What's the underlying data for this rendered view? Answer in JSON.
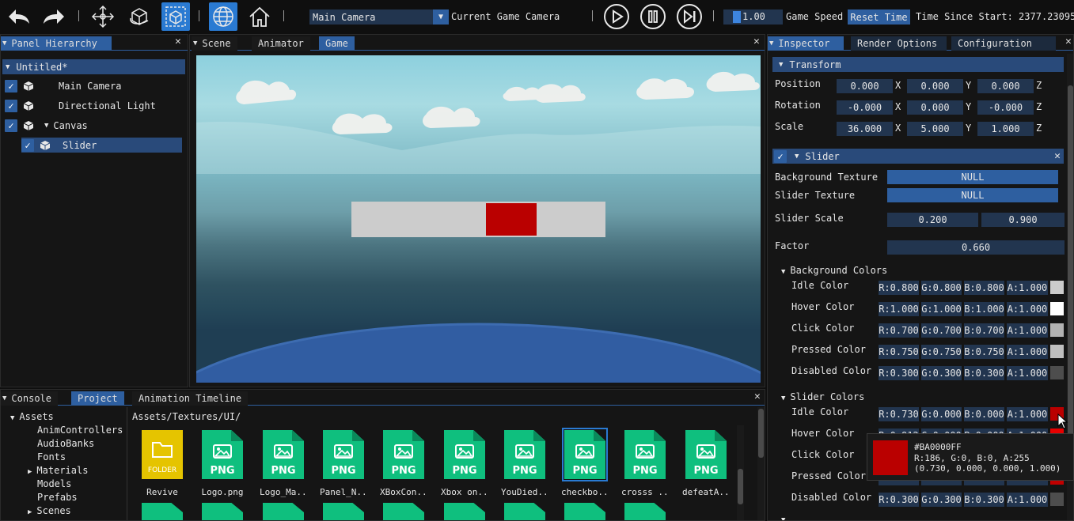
{
  "toolbar": {
    "camera_select": "Main Camera",
    "camera_label": "Current Game Camera",
    "speed_value": "1.00",
    "speed_label": "Game Speed",
    "reset_label": "Reset Time",
    "time_label": "Time Since Start: 2377.230957"
  },
  "hierarchy": {
    "tab": "Panel Hierarchy",
    "root": "Untitled*",
    "items": [
      "Main Camera",
      "Directional Light",
      "Canvas",
      "Slider"
    ]
  },
  "center_tabs": [
    "Scene",
    "Animator",
    "Game"
  ],
  "game_view": {
    "slider_factor": 0.66
  },
  "inspector": {
    "tabs": [
      "Inspector",
      "Render Options",
      "Configuration"
    ],
    "transform": {
      "title": "Transform",
      "rows": [
        {
          "label": "Position",
          "x": "0.000",
          "y": "0.000",
          "z": "0.000"
        },
        {
          "label": "Rotation",
          "x": "-0.000",
          "y": "0.000",
          "z": "-0.000"
        },
        {
          "label": "Scale",
          "x": "36.000",
          "y": "5.000",
          "z": "1.000"
        }
      ],
      "axes": [
        "X",
        "Y",
        "Z"
      ]
    },
    "slider": {
      "title": "Slider",
      "background_texture_label": "Background Texture",
      "background_texture": "NULL",
      "slider_texture_label": "Slider Texture",
      "slider_texture": "NULL",
      "slider_scale_label": "Slider Scale",
      "slider_scale": [
        "0.200",
        "0.900"
      ],
      "factor_label": "Factor",
      "factor": "0.660",
      "bg_colors_title": "Background Colors",
      "bg_colors": [
        {
          "label": "Idle Color",
          "r": "R:0.800",
          "g": "G:0.800",
          "b": "B:0.800",
          "a": "A:1.000",
          "hex": "#cccccc"
        },
        {
          "label": "Hover Color",
          "r": "R:1.000",
          "g": "G:1.000",
          "b": "B:1.000",
          "a": "A:1.000",
          "hex": "#ffffff"
        },
        {
          "label": "Click Color",
          "r": "R:0.700",
          "g": "G:0.700",
          "b": "B:0.700",
          "a": "A:1.000",
          "hex": "#b3b3b3"
        },
        {
          "label": "Pressed Color",
          "r": "R:0.750",
          "g": "G:0.750",
          "b": "B:0.750",
          "a": "A:1.000",
          "hex": "#bfbfbf"
        },
        {
          "label": "Disabled Color",
          "r": "R:0.300",
          "g": "G:0.300",
          "b": "B:0.300",
          "a": "A:1.000",
          "hex": "#4d4d4d"
        }
      ],
      "slider_colors_title": "Slider Colors",
      "slider_colors": [
        {
          "label": "Idle Color",
          "r": "R:0.730",
          "g": "G:0.000",
          "b": "B:0.000",
          "a": "A:1.000",
          "hex": "#ba0000"
        },
        {
          "label": "Hover Color",
          "r": "R:0.912",
          "g": "G:0.000",
          "b": "B:0.000",
          "a": "A:1.000",
          "hex": "#e80000"
        },
        {
          "label": "Click Color",
          "r": "",
          "g": "",
          "b": "",
          "a": "",
          "hex": "#a00000"
        },
        {
          "label": "Pressed Color",
          "r": "",
          "g": "",
          "b": "",
          "a": "",
          "hex": "#c00000"
        },
        {
          "label": "Disabled Color",
          "r": "R:0.300",
          "g": "G:0.300",
          "b": "B:0.300",
          "a": "A:1.000",
          "hex": "#4d4d4d"
        }
      ]
    },
    "tooltip": {
      "hex": "#BA0000FF",
      "rgb": "R:186, G:0, B:0, A:255",
      "floats": "(0.730, 0.000, 0.000, 1.000)",
      "color": "#ba0000"
    }
  },
  "bottom": {
    "tabs": [
      "Console",
      "Project",
      "Animation Timeline"
    ],
    "tree": [
      "Assets",
      "AnimControllers",
      "AudioBanks",
      "Fonts",
      "Materials",
      "Models",
      "Prefabs",
      "Scenes"
    ],
    "path": "Assets/Textures/UI/",
    "folder_label": "FOLDER",
    "png_label": "PNG",
    "files": [
      "Revive",
      "Logo.png",
      "Logo_Ma...",
      "Panel_N...",
      "XBoxCon...",
      "Xbox on...",
      "YouDied...",
      "checkbo...",
      "crosss ...",
      "defeatA..."
    ]
  }
}
